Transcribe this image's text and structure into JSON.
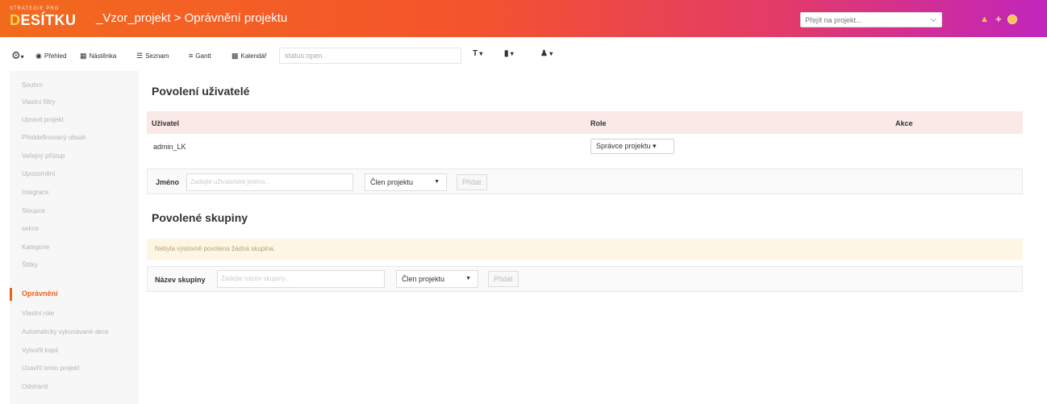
{
  "header": {
    "logo_small": "STRATEGIE PRO",
    "logo_first": "D",
    "logo_rest": "ESÍTKU",
    "title": "_Vzor_projekt > Oprávnění projektu",
    "search_placeholder": "Přejít na projekt..."
  },
  "toolbar": {
    "overview": "Přehled",
    "board": "Nástěnka",
    "list": "Seznam",
    "gantt": "Gantt",
    "calendar": "Kalendář",
    "filter_text": "status:open"
  },
  "sidebar": {
    "items": [
      "Souhrn",
      "Vlastní filtry",
      "Upravit projekt",
      "Předdefinovaný obsah",
      "Veřejný přístup",
      "Upozornění",
      "Integrace",
      "Sloupce",
      "sekce",
      "Kategorie",
      "Štítky",
      "Oprávnění",
      "Vlastní role",
      "Automaticky vykonávané akce",
      "Vytvořit kopii",
      "Uzavřít tento projekt",
      "Odstranit"
    ],
    "active_index": 11
  },
  "users_section": {
    "title": "Povolení uživatelé",
    "columns": {
      "user": "Uživatel",
      "role": "Role",
      "actions": "Akce"
    },
    "rows": [
      {
        "user": "admin_LK",
        "role": "Správce projektu"
      }
    ],
    "form": {
      "name_label": "Jméno",
      "name_placeholder": "Zadejte uživatelské jméno...",
      "role_value": "Člen projektu",
      "add_button": "Přidat"
    }
  },
  "groups_section": {
    "title": "Povolené skupiny",
    "notice": "Nebyla výslovně povolena žádná skupina.",
    "form": {
      "name_label": "Název skupiny",
      "name_placeholder": "Zadejte název skupiny...",
      "role_value": "Člen projektu",
      "add_button": "Přidat"
    }
  }
}
